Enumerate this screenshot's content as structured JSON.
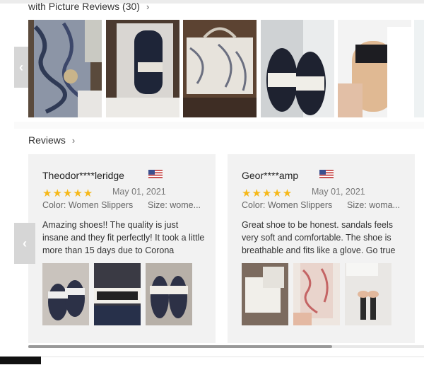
{
  "picture_reviews": {
    "title": "with Picture Reviews (30)"
  },
  "reviews_section": {
    "title": "Reviews"
  },
  "icons": {
    "chevron": "chevron-right-icon",
    "left_arrow": "chevron-left-icon",
    "star": "star-icon",
    "flag": "us-flag-icon"
  },
  "reviews": [
    {
      "name": "Theodor****leridge",
      "stars": "★★★★★",
      "date": "May 01, 2021",
      "color": "Color: Women Slippers",
      "size": "Size: wome...",
      "text": "Amazing shoes!! The quality is just insane and they fit perfectly! It took a little more than 15 days due to Corona"
    },
    {
      "name": "Geor****amp",
      "stars": "★★★★★",
      "date": "May 01, 2021",
      "color": "Color: Women Slippers",
      "size": "Size: woma...",
      "text": "Great shoe to be honest. sandals feels very soft and comfortable. The shoe is breathable and fits like a glove. Go true"
    }
  ],
  "colors": {
    "star": "#f6b819",
    "card_bg": "#f2f2f2"
  }
}
